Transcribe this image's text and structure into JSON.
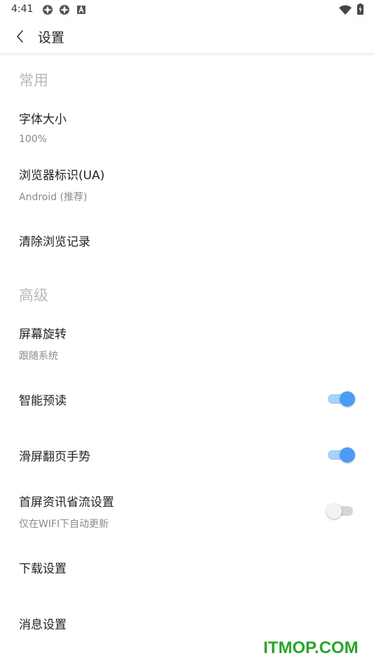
{
  "status_bar": {
    "time": "4:41"
  },
  "toolbar": {
    "title": "设置"
  },
  "sections": {
    "common": {
      "header": "常用",
      "font_size": {
        "title": "字体大小",
        "value": "100%"
      },
      "user_agent": {
        "title": "浏览器标识(UA)",
        "value": "Android (推荐)"
      },
      "clear_history": {
        "title": "清除浏览记录"
      }
    },
    "advanced": {
      "header": "高级",
      "rotation": {
        "title": "屏幕旋转",
        "value": "跟随系统"
      },
      "smart_preread": {
        "title": "智能预读",
        "enabled": true
      },
      "swipe_gesture": {
        "title": "滑屏翻页手势",
        "enabled": true
      },
      "data_saver": {
        "title": "首屏资讯省流设置",
        "subtitle": "仅在WIFI下自动更新",
        "enabled": false
      },
      "download": {
        "title": "下载设置"
      },
      "notification": {
        "title": "消息设置"
      }
    }
  },
  "colors": {
    "accent": "#4c9cf5",
    "accent_track": "#a9d0fb",
    "section_header": "#b8b8b8",
    "subtitle": "#8a8a8a",
    "watermark": "#2aa52a"
  },
  "watermark": "ITMOP.COM"
}
